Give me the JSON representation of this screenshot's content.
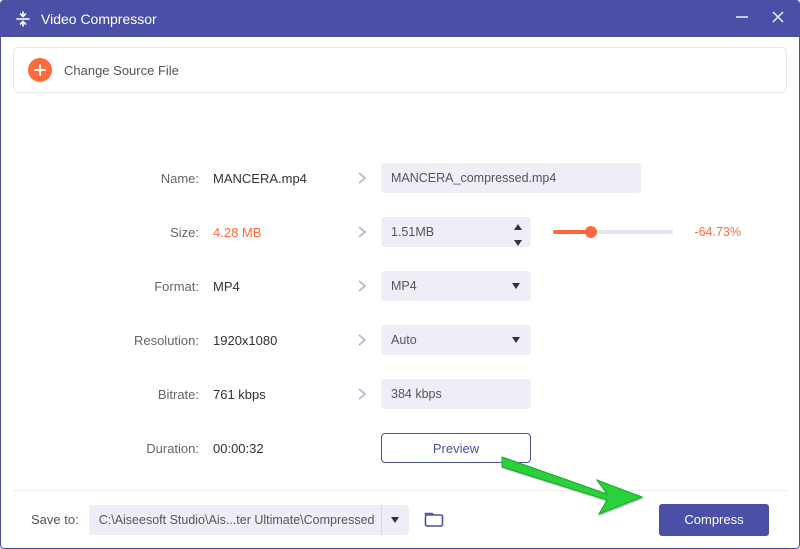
{
  "window": {
    "title": "Video Compressor"
  },
  "source": {
    "label": "Change Source File"
  },
  "rows": {
    "name": {
      "label": "Name:",
      "orig": "MANCERA.mp4",
      "out": "MANCERA_compressed.mp4"
    },
    "size": {
      "label": "Size:",
      "orig": "4.28 MB",
      "out": "1.51MB",
      "pct": "-64.73%"
    },
    "format": {
      "label": "Format:",
      "orig": "MP4",
      "out": "MP4"
    },
    "resolution": {
      "label": "Resolution:",
      "orig": "1920x1080",
      "out": "Auto"
    },
    "bitrate": {
      "label": "Bitrate:",
      "orig": "761 kbps",
      "out": "384 kbps"
    },
    "duration": {
      "label": "Duration:",
      "orig": "00:00:32"
    }
  },
  "buttons": {
    "preview": "Preview",
    "compress": "Compress"
  },
  "save": {
    "label": "Save to:",
    "path": "C:\\Aiseesoft Studio\\Ais...ter Ultimate\\Compressed"
  },
  "colors": {
    "accent": "#4b4fa5",
    "orange": "#ff6a3d"
  }
}
